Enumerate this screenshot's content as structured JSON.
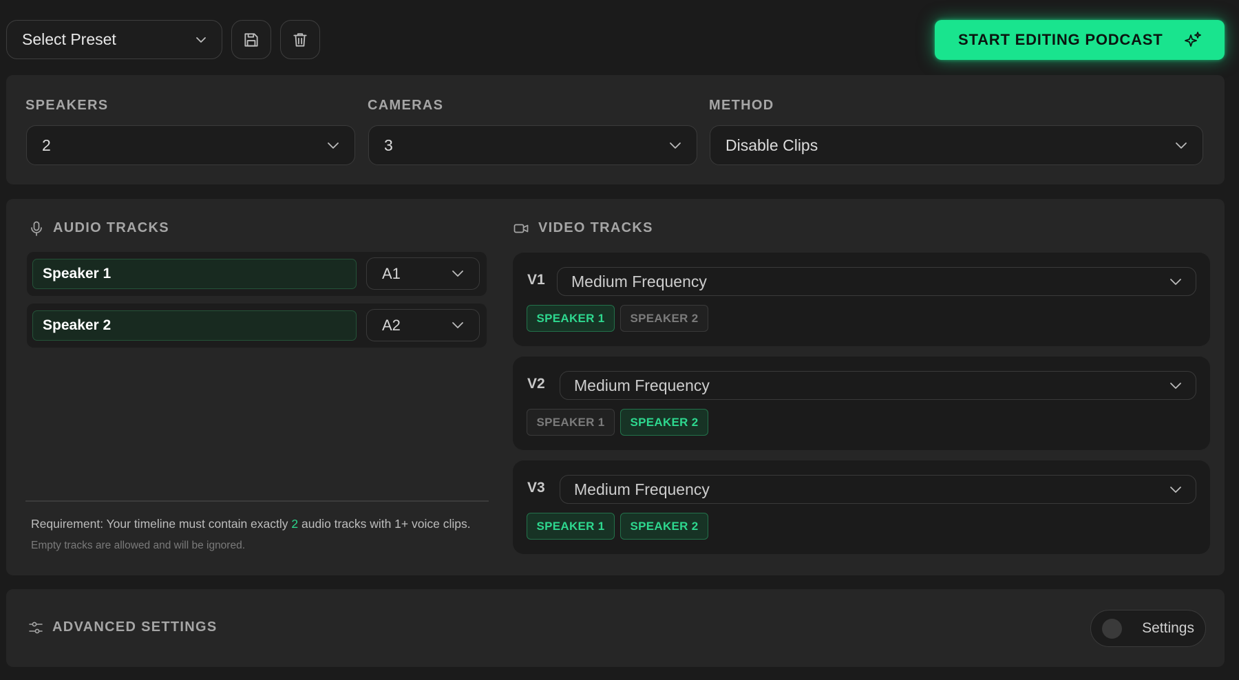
{
  "toolbar": {
    "preset_placeholder": "Select Preset",
    "save_icon": "floppy-disk-icon",
    "delete_icon": "trash-icon",
    "cta_label": "START EDITING PODCAST",
    "cta_icon": "sparkle-icon"
  },
  "config": {
    "speakers": {
      "label": "SPEAKERS",
      "value": "2"
    },
    "cameras": {
      "label": "CAMERAS",
      "value": "3"
    },
    "method": {
      "label": "METHOD",
      "value": "Disable Clips"
    }
  },
  "audio": {
    "title": "AUDIO TRACKS",
    "icon": "microphone-icon",
    "tracks": [
      {
        "name": "Speaker 1",
        "track": "A1"
      },
      {
        "name": "Speaker 2",
        "track": "A2"
      }
    ],
    "requirement": {
      "prefix": "Requirement: Your timeline must contain exactly ",
      "count": "2",
      "suffix": " audio tracks with 1+ voice clips.",
      "note": "Empty tracks are allowed and will be ignored."
    }
  },
  "video": {
    "title": "VIDEO TRACKS",
    "icon": "video-camera-icon",
    "tracks": [
      {
        "label": "V1",
        "frequency": "Medium Frequency",
        "speakers": [
          {
            "label": "SPEAKER 1",
            "selected": true
          },
          {
            "label": "SPEAKER 2",
            "selected": false
          }
        ]
      },
      {
        "label": "V2",
        "frequency": "Medium Frequency",
        "speakers": [
          {
            "label": "SPEAKER 1",
            "selected": false
          },
          {
            "label": "SPEAKER 2",
            "selected": true
          }
        ]
      },
      {
        "label": "V3",
        "frequency": "Medium Frequency",
        "speakers": [
          {
            "label": "SPEAKER 1",
            "selected": true
          },
          {
            "label": "SPEAKER 2",
            "selected": true
          }
        ]
      }
    ]
  },
  "advanced": {
    "title": "ADVANCED SETTINGS",
    "icon": "sliders-icon",
    "toggle_label": "Settings",
    "toggle_on": false
  },
  "colors": {
    "accent": "#19e48e",
    "background": "#1b1b1b",
    "panel": "#262626",
    "chip_selected_text": "#2ed88f"
  }
}
